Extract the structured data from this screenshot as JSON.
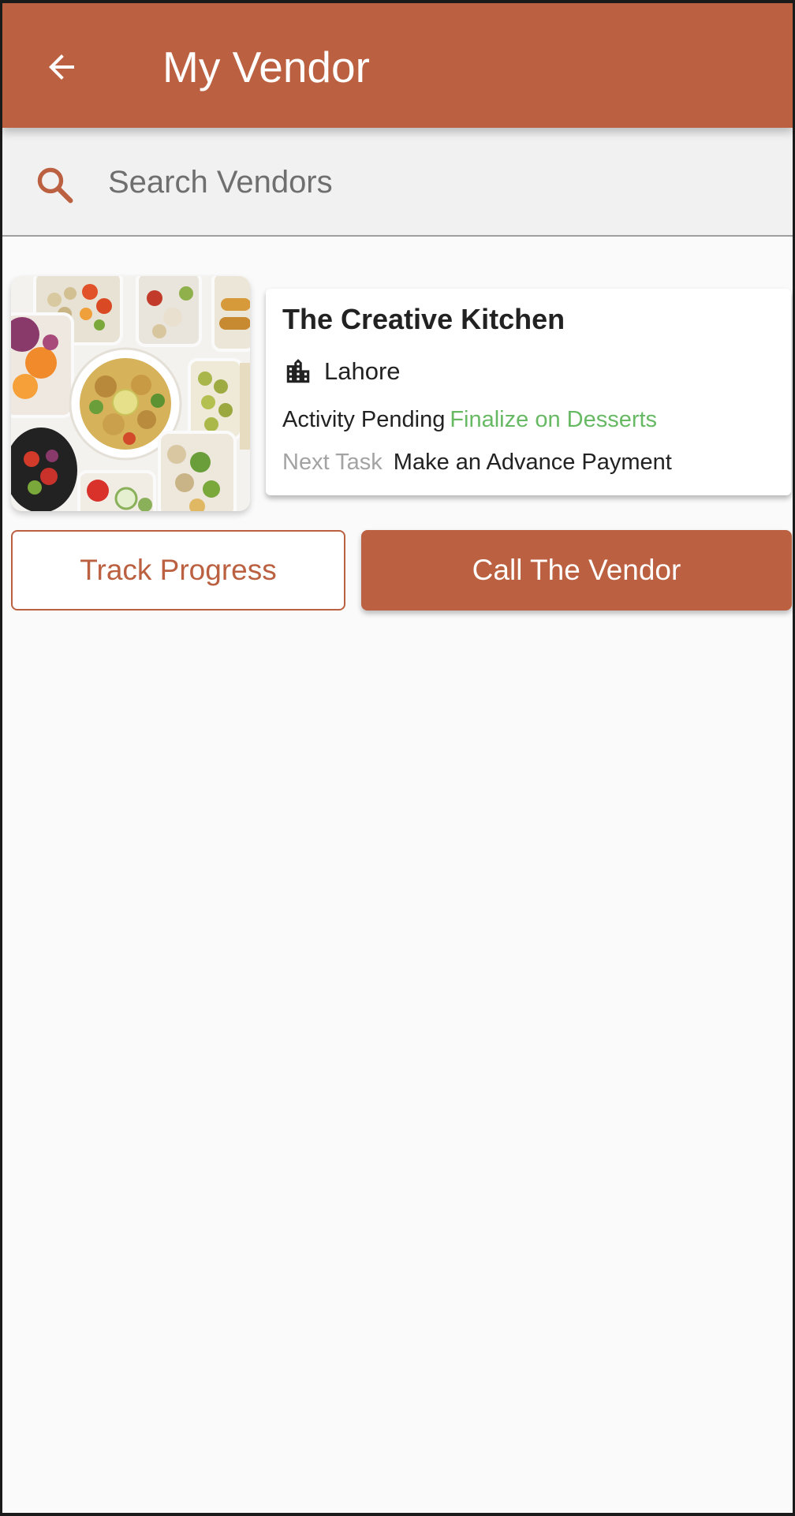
{
  "appbar": {
    "title": "My Vendor",
    "back_icon": "arrow-left-icon",
    "background_color": "#bb6040"
  },
  "search": {
    "placeholder": "Search Vendors",
    "value": "",
    "icon": "search-icon"
  },
  "vendor": {
    "name": "The Creative Kitchen",
    "location": "Lahore",
    "location_icon": "building-icon",
    "activity_label": "Activity Pending",
    "activity_value": "Finalize on Desserts",
    "next_task_label": "Next Task",
    "next_task_value": "Make an Advance Payment",
    "image": "food-platter-image"
  },
  "actions": {
    "track_label": "Track Progress",
    "call_label": "Call The Vendor"
  },
  "colors": {
    "accent": "#bb6040",
    "status_green": "#67b964",
    "muted": "#a3a3a3"
  }
}
